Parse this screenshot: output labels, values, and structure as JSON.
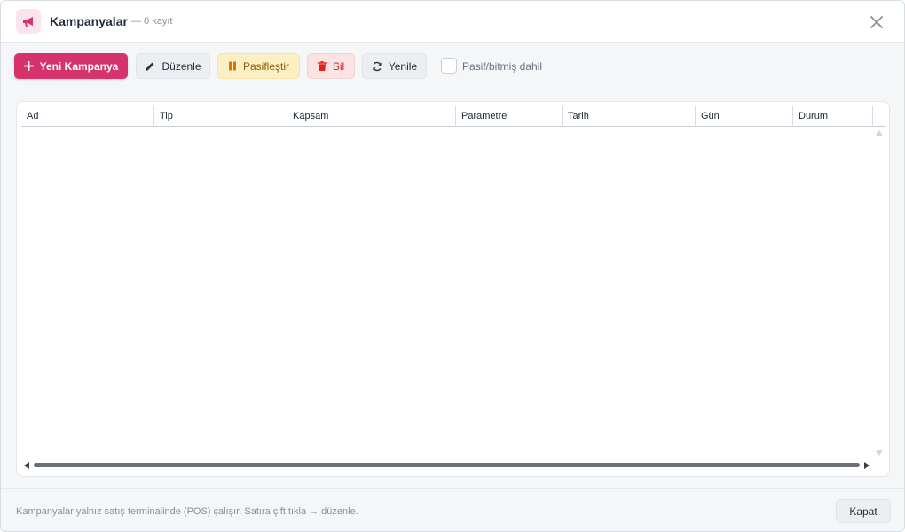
{
  "header": {
    "title": "Kampanyalar",
    "subtitle": "— 0 kayıt",
    "icon": "megaphone-icon",
    "accent_color": "#d6336c"
  },
  "toolbar": {
    "new_label": "Yeni Kampanya",
    "edit_label": "Düzenle",
    "deactivate_label": "Pasifleştir",
    "delete_label": "Sil",
    "refresh_label": "Yenile",
    "include_inactive_label": "Pasif/bitmiş dahil",
    "include_inactive_checked": false
  },
  "table": {
    "columns": [
      "Ad",
      "Tip",
      "Kapsam",
      "Parametre",
      "Tarih",
      "Gün",
      "Durum"
    ],
    "rows": []
  },
  "footer": {
    "note": "Kampanyalar yalnız satış terminalinde (POS) çalışır. Satıra çift tıkla → düzenle.",
    "close_label": "Kapat"
  }
}
